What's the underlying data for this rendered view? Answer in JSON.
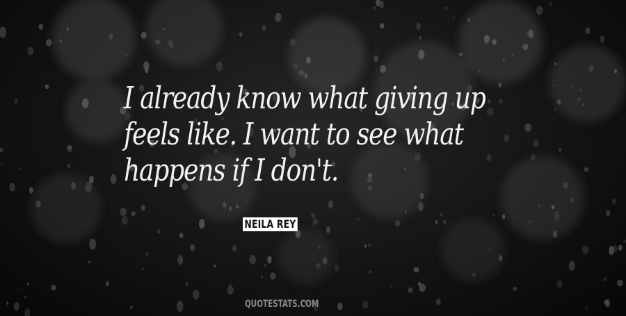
{
  "quote": {
    "lines": [
      "I already know what giving up",
      "feels like. I want to see what",
      "happens if I don't."
    ],
    "author": "NEILA REY"
  },
  "watermark": "QUOTESTATS.COM",
  "colors": {
    "background": "#141414",
    "text": "#f2f2f2",
    "author_badge_bg": "#ffffff",
    "author_badge_text": "#111111",
    "watermark": "#8a8a8a"
  }
}
